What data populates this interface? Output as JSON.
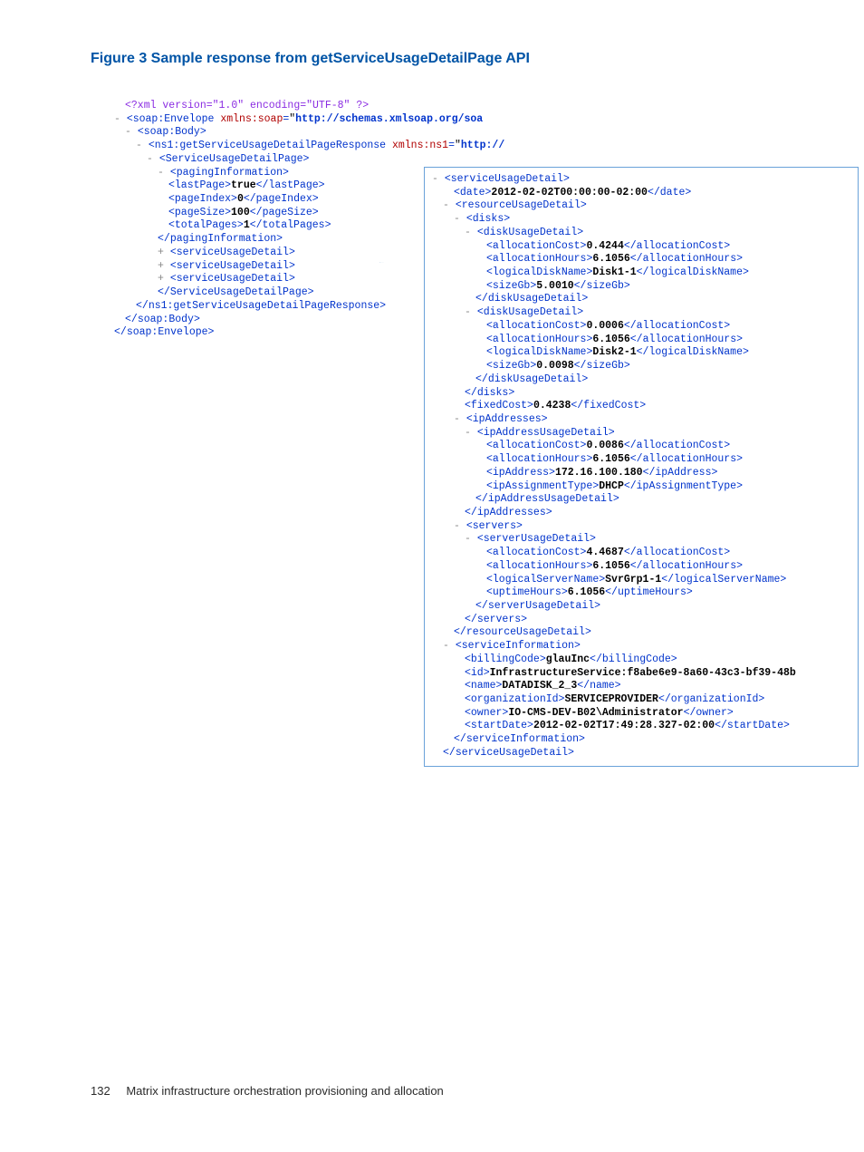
{
  "figure_title": "Figure 3 Sample response from getServiceUsageDetailPage API",
  "footer": {
    "page_number": "132",
    "label": "Matrix infrastructure orchestration provisioning and allocation"
  },
  "xml_left": {
    "decl": "<?xml version=\"1.0\" encoding=\"UTF-8\" ?>",
    "env_open_tag": "soap:Envelope",
    "env_attr_name": "xmlns:soap",
    "env_attr_val": "http://schemas.xmlsoap.org/soa",
    "body_tag": "soap:Body",
    "resp_tag": "ns1:getServiceUsageDetailPageResponse",
    "resp_attr_name": "xmlns:ns1",
    "resp_attr_val": "http://",
    "page_tag": "ServiceUsageDetailPage",
    "paging_tag": "pagingInformation",
    "lastPage": {
      "tag": "lastPage",
      "val": "true"
    },
    "pageIndex": {
      "tag": "pageIndex",
      "val": "0"
    },
    "pageSize": {
      "tag": "pageSize",
      "val": "100"
    },
    "totalPages": {
      "tag": "totalPages",
      "val": "1"
    },
    "sud_tag": "serviceUsageDetail"
  },
  "xml_right": {
    "sud_tag": "serviceUsageDetail",
    "date": {
      "tag": "date",
      "val": "2012-02-02T00:00:00-02:00"
    },
    "rud_tag": "resourceUsageDetail",
    "disks_tag": "disks",
    "dud_tag": "diskUsageDetail",
    "disk1": {
      "allocationCost": "0.4244",
      "allocationHours": "6.1056",
      "logicalDiskName": "Disk1-1",
      "sizeGb": "5.0010"
    },
    "disk2": {
      "allocationCost": "0.0006",
      "allocationHours": "6.1056",
      "logicalDiskName": "Disk2-1",
      "sizeGb": "0.0098"
    },
    "fixedCost": {
      "tag": "fixedCost",
      "val": "0.4238"
    },
    "ipAddresses_tag": "ipAddresses",
    "ipud_tag": "ipAddressUsageDetail",
    "ip": {
      "allocationCost": "0.0086",
      "allocationHours": "6.1056",
      "ipAddress": "172.16.100.180",
      "ipAssignmentType": "DHCP"
    },
    "servers_tag": "servers",
    "svrud_tag": "serverUsageDetail",
    "server": {
      "allocationCost": "4.4687",
      "allocationHours": "6.1056",
      "logicalServerName": "SvrGrp1-1",
      "uptimeHours": "6.1056"
    },
    "si_tag": "serviceInformation",
    "si": {
      "billingCode": "glauInc",
      "id": "InfrastructureService:f8abe6e9-8a60-43c3-bf39-48b",
      "name": "DATADISK_2_3",
      "organizationId": "SERVICEPROVIDER",
      "owner": "IO-CMS-DEV-B02\\Administrator",
      "startDate": "2012-02-02T17:49:28.327-02:00"
    },
    "tags": {
      "allocationCost": "allocationCost",
      "allocationHours": "allocationHours",
      "logicalDiskName": "logicalDiskName",
      "sizeGb": "sizeGb",
      "ipAddress": "ipAddress",
      "ipAssignmentType": "ipAssignmentType",
      "logicalServerName": "logicalServerName",
      "uptimeHours": "uptimeHours",
      "billingCode": "billingCode",
      "id": "id",
      "name": "name",
      "organizationId": "organizationId",
      "owner": "owner",
      "startDate": "startDate"
    }
  }
}
